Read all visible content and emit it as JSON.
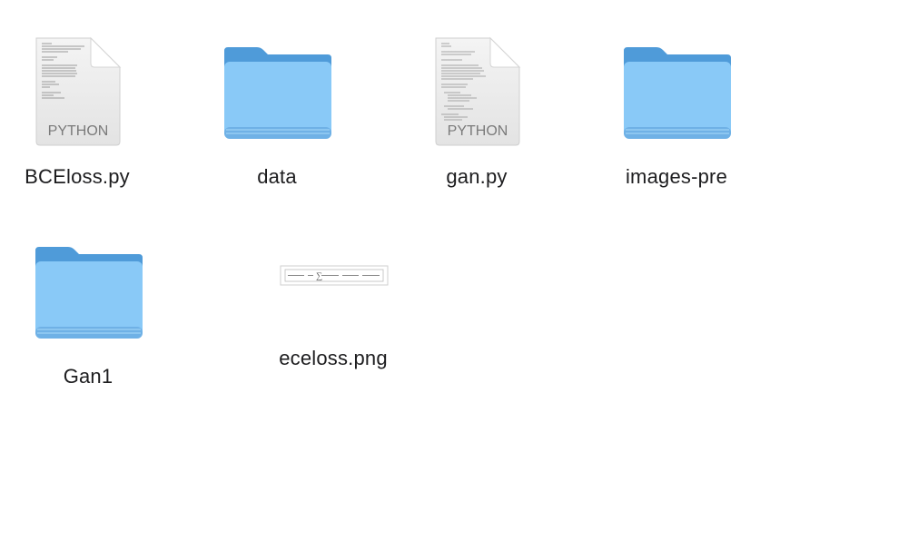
{
  "files": [
    {
      "name": "BCEloss.py",
      "kind": "python",
      "badge": "PYTHON"
    },
    {
      "name": "data",
      "kind": "folder"
    },
    {
      "name": "gan.py",
      "kind": "python",
      "badge": "PYTHON"
    },
    {
      "name": "images-pre",
      "kind": "folder"
    },
    {
      "name": "Gan1",
      "kind": "folder"
    },
    {
      "name": "eceloss.png",
      "kind": "image"
    }
  ],
  "colors": {
    "folder_front": "#89c9f7",
    "folder_back": "#4f9bd9",
    "folder_bottom": "#6fb1e6",
    "doc_paper": "#eeeeee",
    "label_text": "#1d1d1f"
  }
}
